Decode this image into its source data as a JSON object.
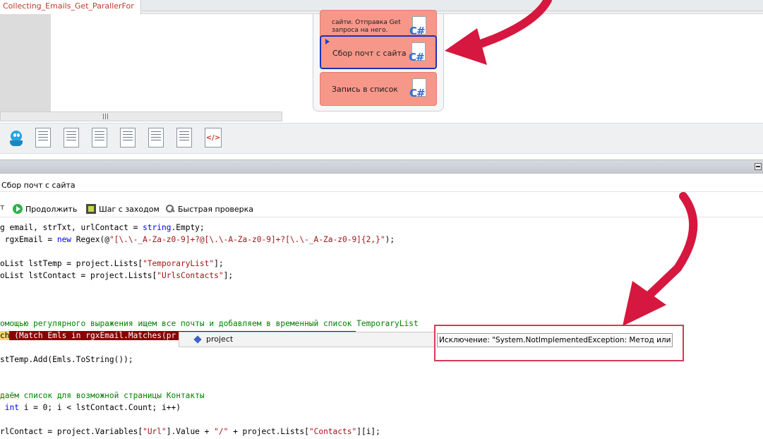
{
  "tabs": {
    "active_tab": "Collecting_Emails_Get_ParallerFor"
  },
  "blocks": [
    {
      "label": "сайти. Отправка Get запроса на него.",
      "icon": "csharp-icon"
    },
    {
      "label": "Сбор почт с сайта",
      "icon": "csharp-icon",
      "selected": true
    },
    {
      "label": "Запись в список",
      "icon": "csharp-icon"
    }
  ],
  "icon_toolbar": {
    "xml_label": "</>"
  },
  "step_title": "Сбор почт с сайта",
  "debug_toolbar": {
    "continue": "Продолжить",
    "step_into": "Шаг с заходом",
    "quick_watch": "Быстрая проверка"
  },
  "code": {
    "l1": "g email, strTxt, urlContact = ",
    "l1_kw": "string",
    "l1_end": ".Empty;",
    "l2_a": " rgxEmail = ",
    "l2_kw": "new",
    "l2_b": " Regex(@",
    "l2_str": "\"[\\.\\-_A-Za-z0-9]+?@[\\.\\-A-Za-z0-9]+?[\\.\\-_A-Za-z0-9]{2,}\"",
    "l2_end": ");",
    "l3_a": "oList lstTemp = project.Lists[",
    "l3_str": "\"TemporaryList\"",
    "l3_end": "];",
    "l4_a": "oList lstContact = project.Lists[",
    "l4_str": "\"UrlsContacts\"",
    "l4_end": "];",
    "l5_cm": "омощью регулярного выражения ищем все почты и добавляем в временный список TemporaryList",
    "l6_y": "ch",
    "l6_rest": " (Match Emls in rgxEmail.Matches(pr",
    "l7": "stTemp.Add(Emls.ToString());",
    "l8_cm": "даём список для возможной страницы Контакты",
    "l9_kw": "int",
    "l9_rest": " i = 0; i < lstContact.Count; i++)",
    "l10_a": "rlContact = project.Variables[",
    "l10_s1": "\"Url\"",
    "l10_b": "].Value + ",
    "l10_s2": "\"/\"",
    "l10_c": " + project.Lists[",
    "l10_s3": "\"Contacts\"",
    "l10_end": "][i];"
  },
  "tooltips": {
    "project": "project",
    "exception": "Исключение: \"System.NotImplementedException: Метод или опер"
  },
  "colors": {
    "block_fill": "#f6978a",
    "selected_border": "#2030b8",
    "highlight_line": "#8b0000",
    "arrow": "#d6173f"
  }
}
